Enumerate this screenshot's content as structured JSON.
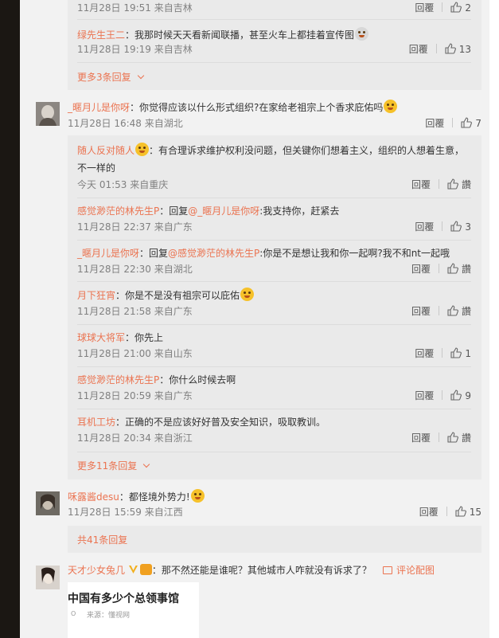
{
  "labels": {
    "reply": "回覆",
    "like_placeholder": "讚",
    "pic_link": "评论配图"
  },
  "thread1": {
    "replies": [
      {
        "name": "",
        "text": "",
        "time": "11月28日 19:51 来自吉林",
        "likes": "2"
      },
      {
        "name": "绿先生王二",
        "text": "：我那时候天天看新闻联播，甚至火车上都挂着宣传图",
        "time": "11月28日 19:19 来自吉林",
        "likes": "13"
      }
    ],
    "more": "更多3条回复"
  },
  "comment2": {
    "name": "_暱月儿是你呀",
    "text": "：你觉得应该以什么形式组织?在家给老祖宗上个香求庇佑吗",
    "time": "11月28日 16:48 来自湖北",
    "likes": "7",
    "replies": [
      {
        "name": "随人反对随人",
        "text1": "：有合理诉求维护权利没问题，但关键你们想着主义，组织的人想着生意，",
        "text2": "不一样的",
        "time": "今天 01:53 来自重庆",
        "likes": ""
      },
      {
        "name": "感觉渺茫的林先生P",
        "mid": "：回复",
        "at": "@_暱月儿是你呀",
        "text": ":我支持你，赶紧去",
        "time": "11月28日 22:37 来自广东",
        "likes": "3"
      },
      {
        "name": "_暱月儿是你呀",
        "mid": "：回复",
        "at": "@感觉渺茫的林先生P",
        "text": ":你是不是想让我和你一起啊?我不和nt一起哦",
        "time": "11月28日 22:30 来自湖北",
        "likes": ""
      },
      {
        "name": "月下狂宵",
        "text": "：你是不是没有祖宗可以庇佑",
        "time": "11月28日 21:58 来自广东",
        "likes": ""
      },
      {
        "name": "球球大将军",
        "text": "：你先上",
        "time": "11月28日 21:00 来自山东",
        "likes": "1"
      },
      {
        "name": "感觉渺茫的林先生P",
        "text": "：你什么时候去啊",
        "time": "11月28日 20:59 来自广东",
        "likes": "9"
      },
      {
        "name": "耳机工坊",
        "text": "：正确的不是应该好好普及安全知识，吸取教训。",
        "time": "11月28日 20:34 来自浙江",
        "likes": ""
      }
    ],
    "more": "更多11条回复"
  },
  "comment3": {
    "name": "咊露酱desu",
    "text": "：都怪境外势力!",
    "time": "11月28日 15:59 来自江西",
    "likes": "15",
    "total": "共41条回复"
  },
  "comment4": {
    "name": "天才少女兔几",
    "text": "：那不然还能是谁呢？其他城市人咋就没有诉求了？",
    "card_title": "驻中国有多少个总领事馆",
    "card_source": "来源：懂视网"
  }
}
